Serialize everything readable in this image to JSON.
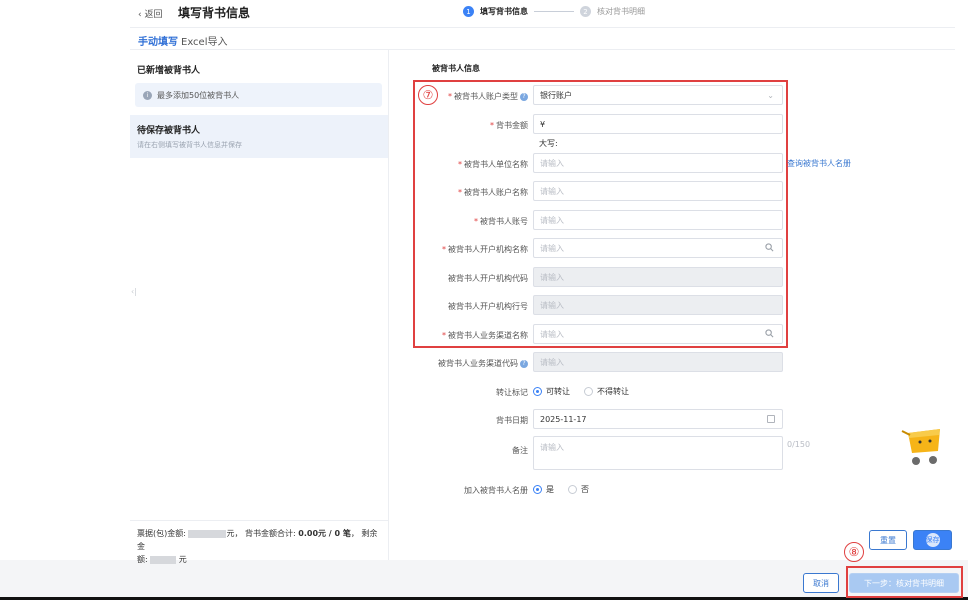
{
  "header": {
    "back_label": "‹ 返回",
    "title": "填写背书信息",
    "steps": [
      {
        "num": "1",
        "label": "填写背书信息",
        "active": true
      },
      {
        "num": "2",
        "label": "核对背书明细",
        "active": false
      }
    ]
  },
  "tabs": [
    {
      "label": "手动填写",
      "active": true
    },
    {
      "label": "Excel导入",
      "active": false
    }
  ],
  "left_panel": {
    "title": "已新增被背书人",
    "info_text": "最多添加50位被背书人",
    "pending_title": "待保存被背书人",
    "pending_sub": "请在右侧填写被背书人信息并保存",
    "footer_line1_prefix": "票据(包)金额:",
    "footer_line1_mid": "元， 背书金额合计:",
    "footer_total": "0.00元 / 0 笔",
    "footer_line1_suffix": "， 剩余金",
    "footer_line2_prefix": "额:",
    "footer_line2_suffix": "元"
  },
  "form": {
    "section_title": "被背书人信息",
    "annotation_7": "⑦",
    "annotation_8": "⑧",
    "account_type": {
      "label": "被背书人账户类型",
      "value": "银行账户"
    },
    "amount": {
      "label": "背书金额",
      "value": "¥",
      "daxie": "大写:"
    },
    "unit_name": {
      "label": "被背书人单位名称",
      "placeholder": "请输入"
    },
    "query_link": "查询被背书人名册",
    "account_name": {
      "label": "被背书人账户名称",
      "placeholder": "请输入"
    },
    "account_no": {
      "label": "被背书人账号",
      "placeholder": "请输入"
    },
    "bank_name": {
      "label": "被背书人开户机构名称",
      "placeholder": "请输入"
    },
    "bank_code": {
      "label": "被背书人开户机构代码",
      "placeholder": "请输入"
    },
    "bank_line": {
      "label": "被背书人开户机构行号",
      "placeholder": "请输入"
    },
    "channel_name": {
      "label": "被背书人业务渠道名称",
      "placeholder": "请输入"
    },
    "channel_code": {
      "label": "被背书人业务渠道代码",
      "placeholder": "请输入"
    },
    "transfer_mark": {
      "label": "转让标记",
      "options": [
        "可转让",
        "不得转让"
      ],
      "selected": "可转让"
    },
    "date": {
      "label": "背书日期",
      "value": "2025-11-17"
    },
    "remark": {
      "label": "备注",
      "placeholder": "请输入",
      "counter": "0/150"
    },
    "add_register": {
      "label": "加入被背书人名册",
      "options": [
        "是",
        "否"
      ],
      "selected": "是"
    }
  },
  "buttons": {
    "reset": "重置",
    "save": "保存",
    "cancel": "取消",
    "next": "下一步：核对背书明细"
  },
  "colors": {
    "accent": "#3b82f6",
    "annotation": "#e04040"
  }
}
